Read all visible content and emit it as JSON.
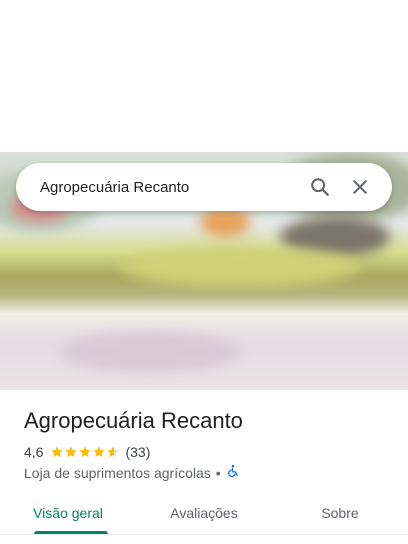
{
  "search": {
    "query": "Agropecuária Recanto"
  },
  "place": {
    "name": "Agropecuária Recanto",
    "rating": "4,6",
    "rating_value": 4.6,
    "review_count": "(33)",
    "category": "Loja de suprimentos agrícolas",
    "separator": "•",
    "accessibility_icon": "wheelchair-icon"
  },
  "tabs": [
    {
      "label": "Visão geral",
      "active": true
    },
    {
      "label": "Avaliações",
      "active": false
    },
    {
      "label": "Sobre",
      "active": false
    }
  ],
  "colors": {
    "accent": "#01875f",
    "star": "#fbbc04",
    "accessibility": "#1a73e8"
  }
}
